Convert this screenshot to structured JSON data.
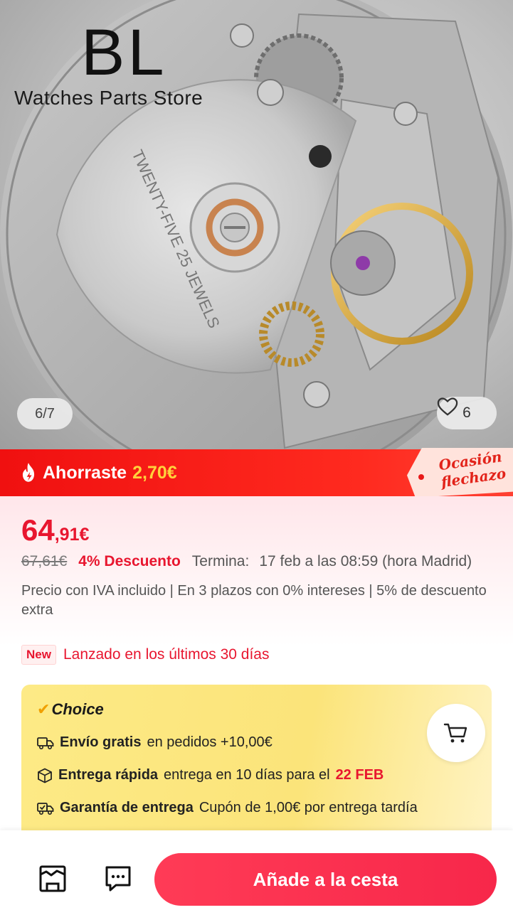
{
  "hero": {
    "brand_mark": "BL",
    "brand_sub": "Watches Parts Store",
    "engraving": "TWENTY-FIVE 25 JEWELS",
    "pager": "6/7",
    "favorites_count": "6"
  },
  "savings": {
    "label": "Ahorraste",
    "amount": "2,70€",
    "flechazo_line1": "Ocasión",
    "flechazo_line2": "flechazo"
  },
  "price": {
    "integer": "64",
    "decimal": ",91€",
    "old_price": "67,61€",
    "discount": "4% Descuento",
    "ends_label": "Termina:",
    "ends_value": "17 feb a las 08:59 (hora Madrid)",
    "tax_note": "Precio con IVA incluido | En 3 plazos con 0% intereses | 5% de descuento extra",
    "new_badge": "New",
    "new_text": "Lanzado en los últimos 30 días"
  },
  "choice": {
    "title": "Choice",
    "shipping_bold": "Envío gratis",
    "shipping_rest": "en pedidos +10,00€",
    "delivery_bold": "Entrega rápida",
    "delivery_rest": "entrega en 10 días para el",
    "delivery_date": "22 FEB",
    "guarantee_bold": "Garantía de entrega",
    "guarantee_rest": "Cupón de 1,00€ por entrega tardía"
  },
  "bottom_bar": {
    "add_to_cart": "Añade a la cesta",
    "icons": [
      "store-icon",
      "chat-icon"
    ]
  },
  "colors": {
    "accent_red": "#e8162f",
    "banner_red": "#f01010",
    "savings_yellow": "#ffd23c",
    "choice_yellow": "#fde784",
    "button_red": "#f7274a"
  }
}
